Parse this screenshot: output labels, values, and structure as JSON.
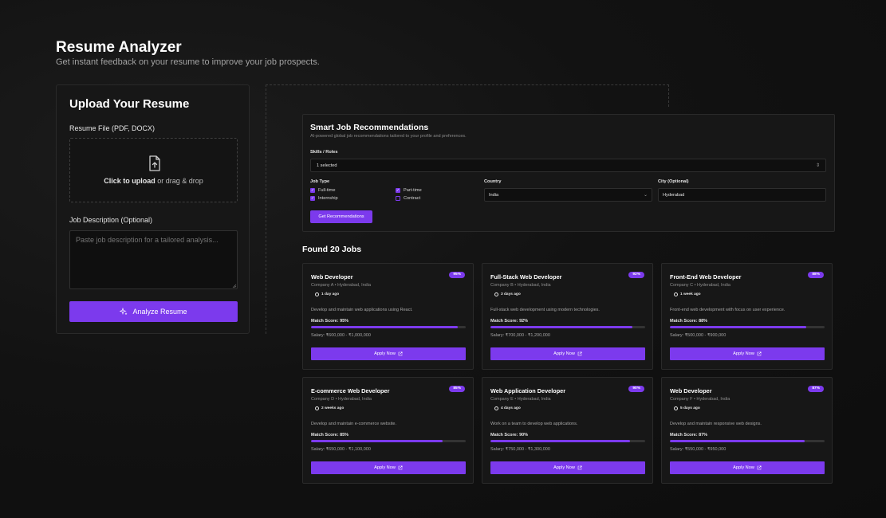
{
  "header": {
    "title": "Resume Analyzer",
    "subtitle": "Get instant feedback on your resume to improve your job prospects."
  },
  "upload": {
    "title": "Upload Your Resume",
    "file_label": "Resume File (PDF, DOCX)",
    "dropzone_strong": "Click to upload",
    "dropzone_rest": " or drag & drop",
    "jd_label": "Job Description (Optional)",
    "jd_placeholder": "Paste job description for a tailored analysis...",
    "analyze_label": "Analyze Resume"
  },
  "recommendations": {
    "title": "Smart Job Recommendations",
    "subtitle": "AI-powered global job recommendations tailored to your profile and preferences.",
    "skills_label": "Skills / Roles",
    "skills_value": "1 selected",
    "job_type_label": "Job Type",
    "job_types": [
      {
        "label": "Full-time",
        "checked": true
      },
      {
        "label": "Part-time",
        "checked": true
      },
      {
        "label": "Internship",
        "checked": true
      },
      {
        "label": "Contract",
        "checked": false
      }
    ],
    "country_label": "Country",
    "country_value": "India",
    "city_label": "City (Optional)",
    "city_value": "Hyderabad",
    "button_label": "Get Recommendations"
  },
  "results": {
    "found_label": "Found 20 Jobs",
    "apply_label": "Apply Now",
    "jobs": [
      {
        "title": "Web Developer",
        "badge": "95%",
        "company": "Company A • Hyderabad, India",
        "posted": "1 day ago",
        "description": "Develop and maintain web applications using React.",
        "match_label": "Match Score: 95%",
        "match": 95,
        "salary": "Salary: ₹600,000 - ₹1,000,000"
      },
      {
        "title": "Full-Stack Web Developer",
        "badge": "92%",
        "company": "Company B • Hyderabad, India",
        "posted": "3 days ago",
        "description": "Full-stack web development using modern technologies.",
        "match_label": "Match Score: 92%",
        "match": 92,
        "salary": "Salary: ₹700,000 - ₹1,200,000"
      },
      {
        "title": "Front-End Web Developer",
        "badge": "88%",
        "company": "Company C • Hyderabad, India",
        "posted": "1 week ago",
        "description": "Front-end web development with focus on user experience.",
        "match_label": "Match Score: 88%",
        "match": 88,
        "salary": "Salary: ₹500,000 - ₹900,000"
      },
      {
        "title": "E-commerce Web Developer",
        "badge": "85%",
        "company": "Company D • Hyderabad, India",
        "posted": "2 weeks ago",
        "description": "Develop and maintain e-commerce website.",
        "match_label": "Match Score: 85%",
        "match": 85,
        "salary": "Salary: ₹650,000 - ₹1,100,000"
      },
      {
        "title": "Web Application Developer",
        "badge": "90%",
        "company": "Company E • Hyderabad, India",
        "posted": "4 days ago",
        "description": "Work on a team to develop web applications.",
        "match_label": "Match Score: 90%",
        "match": 90,
        "salary": "Salary: ₹750,000 - ₹1,300,000"
      },
      {
        "title": "Web Developer",
        "badge": "87%",
        "company": "Company F • Hyderabad, India",
        "posted": "5 days ago",
        "description": "Develop and maintain responsive web designs.",
        "match_label": "Match Score: 87%",
        "match": 87,
        "salary": "Salary: ₹550,000 - ₹950,000"
      }
    ]
  },
  "colors": {
    "accent": "#7c3aed",
    "background": "#121212",
    "panel": "#171717"
  }
}
